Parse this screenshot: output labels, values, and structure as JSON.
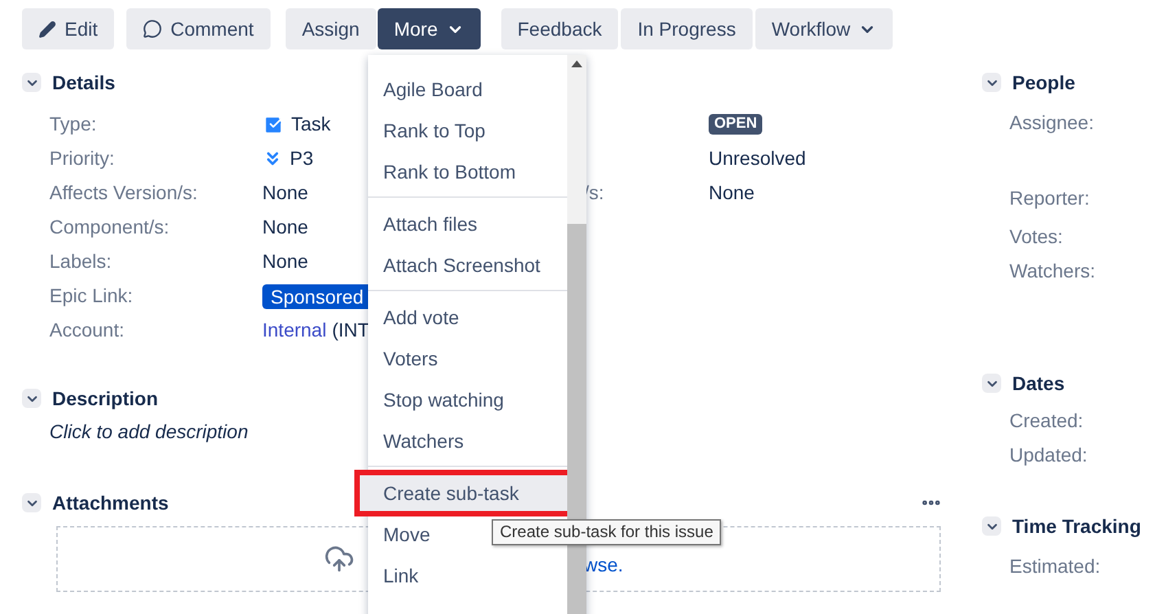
{
  "toolbar": [
    {
      "label": "Edit",
      "kind": "pencil",
      "selected": false
    },
    {
      "label": "Comment",
      "kind": "comment",
      "selected": false
    },
    {
      "label": "Assign",
      "kind": "text",
      "selected": false
    },
    {
      "label": "More",
      "kind": "dropdown",
      "selected": true
    },
    {
      "label": "Feedback",
      "kind": "text",
      "selected": false
    },
    {
      "label": "In Progress",
      "kind": "text",
      "selected": false
    },
    {
      "label": "Workflow",
      "kind": "dropdown",
      "selected": false
    }
  ],
  "details": {
    "title": "Details",
    "expanded": true,
    "left": [
      {
        "label": "Type:",
        "value": "Task",
        "kind": "type"
      },
      {
        "label": "Priority:",
        "value": "P3",
        "kind": "priority"
      },
      {
        "label": "Affects Version/s:",
        "value": "None",
        "kind": "text"
      },
      {
        "label": "Component/s:",
        "value": "None",
        "kind": "text"
      },
      {
        "label": "Labels:",
        "value": "None",
        "kind": "text"
      },
      {
        "label": "Epic Link:",
        "value": "Sponsored",
        "kind": "badge"
      },
      {
        "label": "Account:",
        "value": "Internal",
        "suffix": "(INT",
        "kind": "link"
      }
    ],
    "right": [
      {
        "value": "OPEN",
        "kind": "status"
      },
      {
        "value": "Unresolved",
        "kind": "text"
      },
      {
        "label": "/s:",
        "value": "None",
        "kind": "text"
      }
    ]
  },
  "description": {
    "title": "Description",
    "expanded": true,
    "placeholder": "Click to add description"
  },
  "attachments": {
    "title": "Attachments",
    "expanded": true,
    "link": "wse."
  },
  "people": {
    "title": "People",
    "expanded": true,
    "fields": [
      {
        "label": "Assignee:"
      },
      {
        "label": "Reporter:"
      },
      {
        "label": "Votes:"
      },
      {
        "label": "Watchers:"
      }
    ]
  },
  "dates": {
    "title": "Dates",
    "expanded": true,
    "fields": [
      {
        "label": "Created:"
      },
      {
        "label": "Updated:"
      }
    ]
  },
  "time_tracking": {
    "title": "Time Tracking",
    "expanded": true,
    "fields": [
      {
        "label": "Estimated:"
      }
    ]
  },
  "menu": {
    "groups": [
      [
        {
          "label": "Agile Board",
          "selected": false,
          "highlighted": false
        },
        {
          "label": "Rank to Top",
          "selected": false,
          "highlighted": false
        },
        {
          "label": "Rank to Bottom",
          "selected": false,
          "highlighted": false
        }
      ],
      [
        {
          "label": "Attach files",
          "selected": false,
          "highlighted": false
        },
        {
          "label": "Attach Screenshot",
          "selected": false,
          "highlighted": false
        }
      ],
      [
        {
          "label": "Add vote",
          "selected": false,
          "highlighted": false
        },
        {
          "label": "Voters",
          "selected": false,
          "highlighted": false
        },
        {
          "label": "Stop watching",
          "selected": false,
          "highlighted": false
        },
        {
          "label": "Watchers",
          "selected": false,
          "highlighted": false
        }
      ],
      [
        {
          "label": "Create sub-task",
          "selected": true,
          "highlighted": true
        },
        {
          "label": "Move",
          "selected": false,
          "highlighted": false
        },
        {
          "label": "Link",
          "selected": false,
          "highlighted": false
        }
      ]
    ]
  },
  "tooltip": "Create sub-task for this issue"
}
